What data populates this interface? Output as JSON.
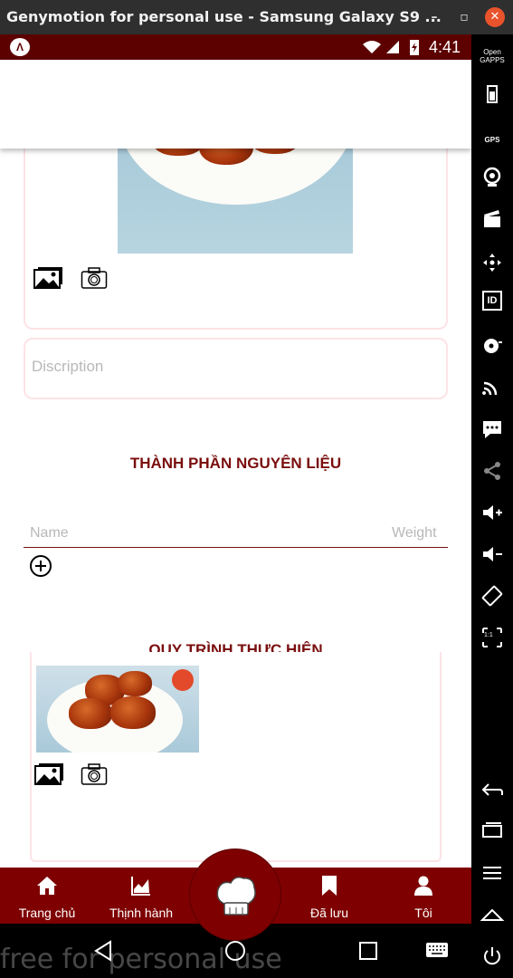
{
  "window": {
    "title": "Genymotion for personal use - Samsung Galaxy S9 ...",
    "minimize": "–",
    "maximize": "▫",
    "close": "✕"
  },
  "statusbar": {
    "time": "4:41",
    "app_logo": "Λ"
  },
  "form": {
    "description_placeholder": "Discription",
    "ingredients_title": "THÀNH PHẦN NGUYÊN LIỆU",
    "name_placeholder": "Name",
    "weight_placeholder": "Weight",
    "steps_title": "QUY TRÌNH THỰC HIỆN"
  },
  "bottom_nav": {
    "items": [
      {
        "label": "Trang chủ",
        "icon": "home-icon"
      },
      {
        "label": "Thịnh hành",
        "icon": "trending-chart-icon"
      },
      {
        "label": "Đã lưu",
        "icon": "bookmark-icon"
      },
      {
        "label": "Tôi",
        "icon": "person-icon"
      }
    ],
    "center_icon": "chef-hat-icon"
  },
  "sidebar": {
    "open_gapps_label": "Open GAPPS",
    "gps_label": "GPS",
    "id_label": "ID",
    "ratio_label": "1:1"
  },
  "watermark": "free for personal use",
  "colors": {
    "brand": "#7e0000",
    "statusbar": "#5c0000",
    "title": "#7a0e0e",
    "card_border": "#fde3e6"
  }
}
